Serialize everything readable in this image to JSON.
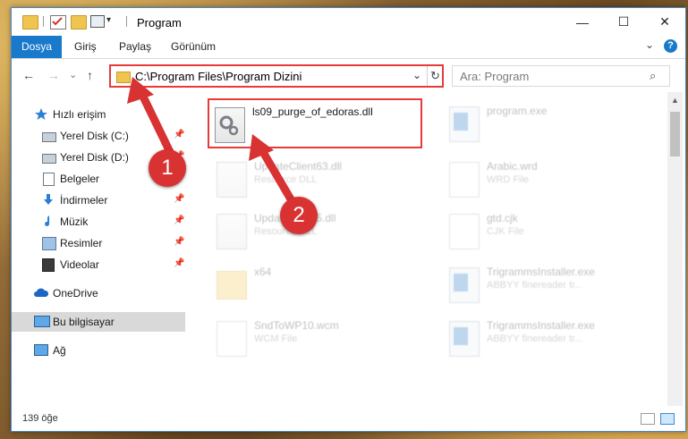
{
  "window": {
    "title": "Program",
    "minimize_glyph": "—",
    "maximize_glyph": "☐",
    "close_glyph": "✕"
  },
  "ribbon": {
    "tabs": [
      "Dosya",
      "Giriş",
      "Paylaş",
      "Görünüm"
    ],
    "expand_glyph": "⌄",
    "help_glyph": "?"
  },
  "nav": {
    "back_glyph": "←",
    "forward_glyph": "→",
    "recent_glyph": "⌄",
    "up_glyph": "↑"
  },
  "address": {
    "path": "C:\\Program Files\\Program Dizini",
    "dropdown_glyph": "⌄",
    "refresh_glyph": "↻"
  },
  "search": {
    "placeholder": "Ara: Program",
    "icon": "search-icon",
    "glyph": "⌕"
  },
  "sidebar": {
    "items": [
      {
        "label": "Hızlı erişim",
        "icon": "star-icon"
      },
      {
        "label": "Yerel Disk (C:)",
        "icon": "drive-icon",
        "pinned": true
      },
      {
        "label": "Yerel Disk (D:)",
        "icon": "drive-icon",
        "pinned": true
      },
      {
        "label": "Belgeler",
        "icon": "documents-icon"
      },
      {
        "label": "İndirmeler",
        "icon": "download-icon",
        "pinned": true
      },
      {
        "label": "Müzik",
        "icon": "music-icon",
        "pinned": true
      },
      {
        "label": "Resimler",
        "icon": "pictures-icon",
        "pinned": true
      },
      {
        "label": "Videolar",
        "icon": "videos-icon",
        "pinned": true
      },
      {
        "label": "OneDrive",
        "icon": "cloud-icon"
      },
      {
        "label": "Bu bilgisayar",
        "icon": "computer-icon"
      },
      {
        "label": "Ağ",
        "icon": "network-icon"
      }
    ],
    "pin_glyph": "📌"
  },
  "files": [
    {
      "name": "ls09_purge_of_edoras.dll",
      "type": "",
      "icon": "dll-file-icon",
      "highlighted": true
    },
    {
      "name": "program.exe",
      "type": "",
      "icon": "exe-file-icon"
    },
    {
      "name": "UpdateClient63.dll",
      "type": "Resource DLL",
      "icon": "dll-file-icon"
    },
    {
      "name": "Arabic.wrd",
      "type": "WRD File",
      "icon": "doc-file-icon"
    },
    {
      "name": "UpdateClient5.dll",
      "type": "Resource DLL",
      "icon": "dll-file-icon"
    },
    {
      "name": "gtd.cjk",
      "type": "CJK File",
      "icon": "doc-file-icon"
    },
    {
      "name": "x64",
      "type": "",
      "icon": "folder-icon"
    },
    {
      "name": "TrigrammsInstaller.exe",
      "type": "ABBYY finereader tr...",
      "icon": "exe-file-icon"
    },
    {
      "name": "SndToWP10.wcm",
      "type": "WCM File",
      "icon": "doc-file-icon"
    },
    {
      "name": "TrigrammsInstaller.exe",
      "type": "ABBYY finereader tr...",
      "icon": "exe-file-icon"
    }
  ],
  "status": {
    "item_count": "139 öğe"
  },
  "annotations": {
    "step1": "1",
    "step2": "2",
    "color": "#d83232"
  }
}
